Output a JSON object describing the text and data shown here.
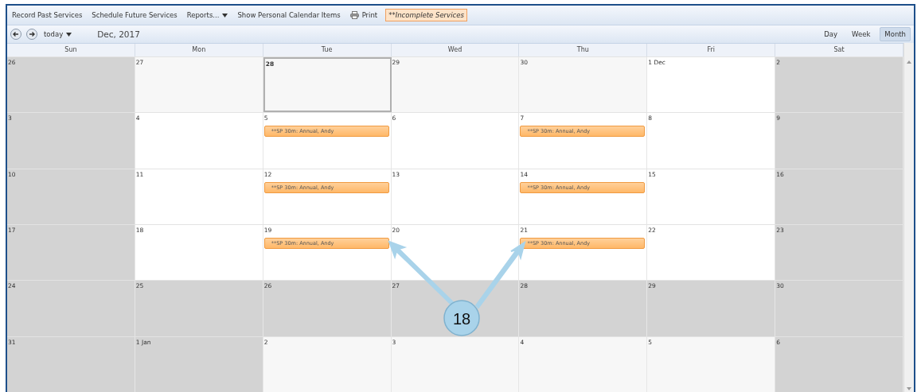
{
  "toolbar": {
    "items": [
      {
        "kind": "link",
        "label": "Record Past Services"
      },
      {
        "kind": "link",
        "label": "Schedule Future Services"
      },
      {
        "kind": "dropdown",
        "label": "Reports..."
      },
      {
        "kind": "link",
        "label": "Show Personal Calendar Items"
      },
      {
        "kind": "print",
        "label": "Print"
      },
      {
        "kind": "highlight",
        "label": "**Incomplete Services"
      }
    ]
  },
  "nav": {
    "today": "today",
    "title": "Dec, 2017",
    "views": [
      {
        "label": "Day",
        "selected": false
      },
      {
        "label": "Week",
        "selected": false
      },
      {
        "label": "Month",
        "selected": true
      }
    ]
  },
  "weekdays": [
    "Sun",
    "Mon",
    "Tue",
    "Wed",
    "Thu",
    "Fri",
    "Sat"
  ],
  "weeks": [
    {
      "days": [
        {
          "label": "26",
          "kind": "closed",
          "selected": false
        },
        {
          "label": "27",
          "kind": "other",
          "selected": false
        },
        {
          "label": "28",
          "kind": "other",
          "selected": true
        },
        {
          "label": "29",
          "kind": "other",
          "selected": false
        },
        {
          "label": "30",
          "kind": "other",
          "selected": false
        },
        {
          "label": "1 Dec",
          "kind": "open",
          "selected": false
        },
        {
          "label": "2",
          "kind": "closed",
          "selected": false
        }
      ]
    },
    {
      "days": [
        {
          "label": "3",
          "kind": "closed",
          "selected": false
        },
        {
          "label": "4",
          "kind": "open",
          "selected": false
        },
        {
          "label": "5",
          "kind": "open",
          "selected": false,
          "events": [
            "**SP 30m: Annual, Andy"
          ]
        },
        {
          "label": "6",
          "kind": "open",
          "selected": false
        },
        {
          "label": "7",
          "kind": "open",
          "selected": false,
          "events": [
            "**SP 30m: Annual, Andy"
          ]
        },
        {
          "label": "8",
          "kind": "open",
          "selected": false
        },
        {
          "label": "9",
          "kind": "closed",
          "selected": false
        }
      ]
    },
    {
      "days": [
        {
          "label": "10",
          "kind": "closed",
          "selected": false
        },
        {
          "label": "11",
          "kind": "open",
          "selected": false
        },
        {
          "label": "12",
          "kind": "open",
          "selected": false,
          "events": [
            "**SP 30m: Annual, Andy"
          ]
        },
        {
          "label": "13",
          "kind": "open",
          "selected": false
        },
        {
          "label": "14",
          "kind": "open",
          "selected": false,
          "events": [
            "**SP 30m: Annual, Andy"
          ]
        },
        {
          "label": "15",
          "kind": "open",
          "selected": false
        },
        {
          "label": "16",
          "kind": "closed",
          "selected": false
        }
      ]
    },
    {
      "days": [
        {
          "label": "17",
          "kind": "closed",
          "selected": false
        },
        {
          "label": "18",
          "kind": "open",
          "selected": false
        },
        {
          "label": "19",
          "kind": "open",
          "selected": false,
          "events": [
            "**SP 30m: Annual, Andy"
          ]
        },
        {
          "label": "20",
          "kind": "open",
          "selected": false
        },
        {
          "label": "21",
          "kind": "open",
          "selected": false,
          "events": [
            "**SP 30m: Annual, Andy"
          ]
        },
        {
          "label": "22",
          "kind": "open",
          "selected": false
        },
        {
          "label": "23",
          "kind": "closed",
          "selected": false
        }
      ]
    },
    {
      "days": [
        {
          "label": "24",
          "kind": "closed",
          "selected": false
        },
        {
          "label": "25",
          "kind": "closed",
          "selected": false
        },
        {
          "label": "26",
          "kind": "closed",
          "selected": false
        },
        {
          "label": "27",
          "kind": "closed",
          "selected": false
        },
        {
          "label": "28",
          "kind": "closed",
          "selected": false
        },
        {
          "label": "29",
          "kind": "closed",
          "selected": false
        },
        {
          "label": "30",
          "kind": "closed",
          "selected": false
        }
      ]
    },
    {
      "days": [
        {
          "label": "31",
          "kind": "closed",
          "selected": false
        },
        {
          "label": "1 Jan",
          "kind": "closed",
          "selected": false
        },
        {
          "label": "2",
          "kind": "other",
          "selected": false
        },
        {
          "label": "3",
          "kind": "other",
          "selected": false
        },
        {
          "label": "4",
          "kind": "other",
          "selected": false
        },
        {
          "label": "5",
          "kind": "other",
          "selected": false
        },
        {
          "label": "6",
          "kind": "closed",
          "selected": false
        }
      ]
    }
  ],
  "callout": {
    "label": "18"
  }
}
